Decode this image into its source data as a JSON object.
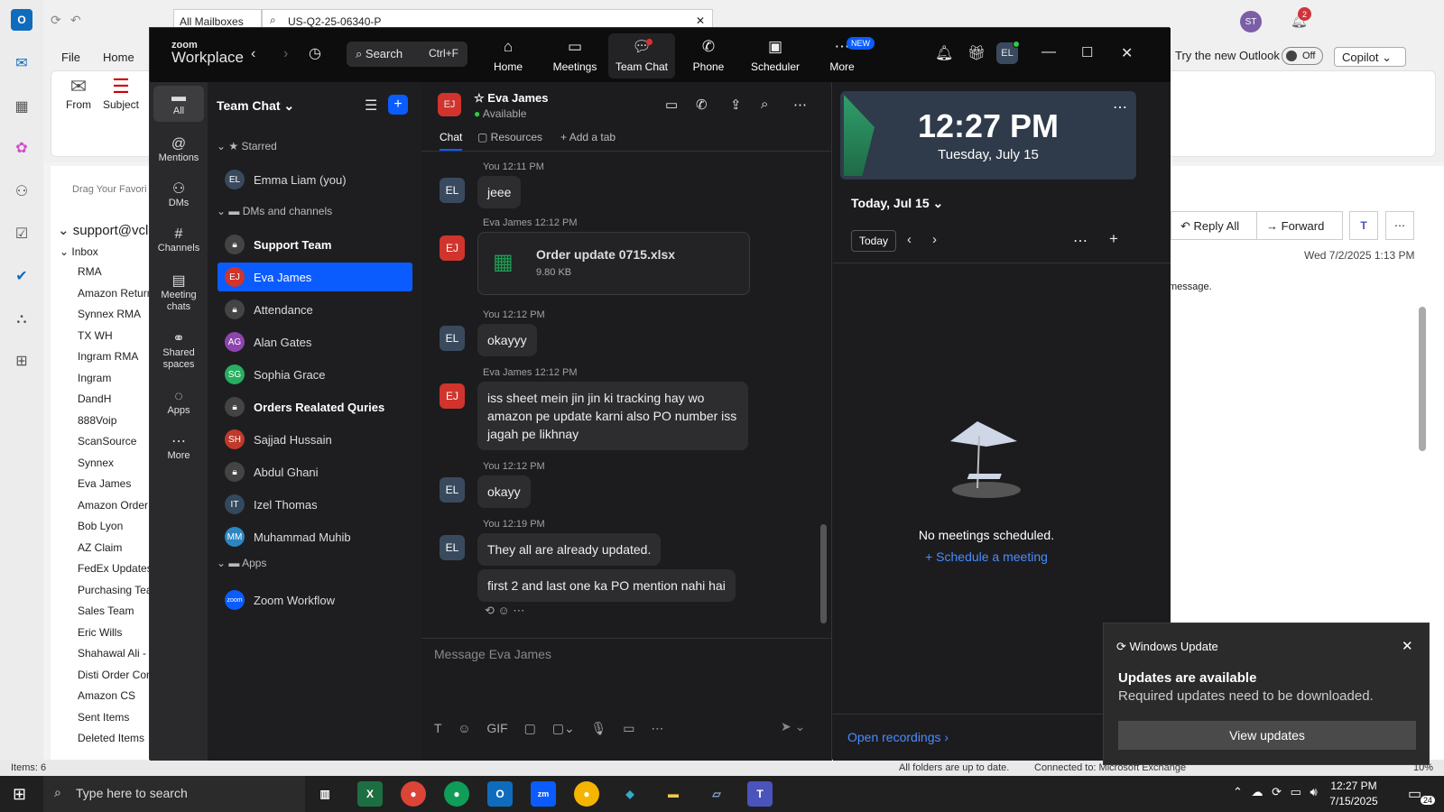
{
  "outlook": {
    "mailbox_select": "All Mailboxes",
    "search_value": "US-Q2-25-06340-P",
    "menu": [
      "File",
      "Home"
    ],
    "ribbon": {
      "from": "From",
      "subject": "Subject"
    },
    "drag_favorites": "Drag Your Favori",
    "account": "support@vclc",
    "inbox": "Inbox",
    "folders": [
      "RMA",
      "Amazon Return",
      "Synnex RMA",
      "TX WH",
      "Ingram RMA",
      "Ingram",
      "DandH",
      "888Voip",
      "ScanSource",
      "Synnex",
      "Eva James",
      "Amazon Order",
      "Bob Lyon",
      "AZ Claim",
      "FedEx Updates",
      "Purchasing Tea",
      "Sales Team",
      "Eric Wills",
      "Shahawal Ali -",
      "Disti Order Con",
      "Amazon CS",
      "Sent Items",
      "Deleted Items"
    ],
    "try_new": "Try the new Outlook",
    "toggle": "Off",
    "copilot": "Copilot",
    "user_initials": "ST",
    "notif_count": "2",
    "reply_all": "Reply All",
    "forward": "Forward",
    "date": "Wed 7/2/2025 1:13 PM",
    "message_snippet": "message.",
    "status_items": "Items: 6",
    "status_folders": "All folders are up to date.",
    "status_conn": "Connected to: Microsoft Exchange",
    "zoom_pct": "10%"
  },
  "zoom": {
    "brand_top": "zoom",
    "brand": "Workplace",
    "search": "Search",
    "search_shortcut": "Ctrl+F",
    "nav": [
      {
        "label": "Home"
      },
      {
        "label": "Meetings"
      },
      {
        "label": "Team Chat"
      },
      {
        "label": "Phone"
      },
      {
        "label": "Scheduler"
      },
      {
        "label": "More",
        "badge": "NEW"
      }
    ],
    "avatar": "EL",
    "side": [
      {
        "label": "All"
      },
      {
        "label": "Mentions"
      },
      {
        "label": "DMs"
      },
      {
        "label": "Channels"
      },
      {
        "label": "Meeting chats"
      },
      {
        "label": "Shared spaces"
      },
      {
        "label": "Apps"
      },
      {
        "label": "More"
      }
    ],
    "list_title": "Team Chat",
    "sections": {
      "starred": "Starred",
      "dms": "DMs and channels",
      "apps": "Apps"
    },
    "items": [
      {
        "initials": "EL",
        "name": "Emma Liam (you)",
        "color": "#3a4a5e"
      },
      {
        "initials": "",
        "name": "Support Team",
        "bold": true
      },
      {
        "initials": "EJ",
        "name": "Eva James",
        "color": "#d0342c"
      },
      {
        "initials": "",
        "name": "Attendance"
      },
      {
        "initials": "AG",
        "name": "Alan Gates",
        "color": "#8e44ad"
      },
      {
        "initials": "SG",
        "name": "Sophia Grace",
        "color": "#27ae60"
      },
      {
        "initials": "",
        "name": "Orders Realated Quries",
        "bold": true
      },
      {
        "initials": "SH",
        "name": "Sajjad Hussain",
        "color": "#c0392b"
      },
      {
        "initials": "",
        "name": "Abdul Ghani",
        "color": "#777"
      },
      {
        "initials": "IT",
        "name": "Izel Thomas",
        "color": "#34495e"
      },
      {
        "initials": "MM",
        "name": "Muhammad Muhib",
        "color": "#2e86c1"
      },
      {
        "initials": "zoom",
        "name": "Zoom Workflow",
        "color": "#0b5cff"
      }
    ],
    "chat": {
      "name": "Eva James",
      "status": "Available",
      "initials": "EJ",
      "tabs": [
        "Chat",
        "Resources",
        "Add a tab"
      ],
      "messages": [
        {
          "header": "You 12:11 PM",
          "text": "jeee"
        },
        {
          "header": "Eva James 12:12 PM",
          "file": "Order update 0715.xlsx",
          "size": "9.80 KB"
        },
        {
          "header": "You 12:12 PM",
          "text": "okayyy"
        },
        {
          "header": "Eva James 12:12 PM",
          "text": "iss sheet mein jin jin ki tracking hay wo amazon pe update karni also PO number iss jagah pe likhnay"
        },
        {
          "header": "You 12:12 PM",
          "text": "okayy"
        },
        {
          "header": "You 12:19 PM",
          "text": "They all are already updated."
        },
        {
          "header": "",
          "text": "first 2 and last one ka PO mention nahi hai"
        }
      ],
      "placeholder": "Message Eva James"
    },
    "cal": {
      "time": "12:27 PM",
      "date": "Tuesday, July 15",
      "today_label": "Today, Jul 15",
      "today_btn": "Today",
      "empty": "No meetings scheduled.",
      "schedule": "Schedule a meeting",
      "recordings": "Open recordings"
    }
  },
  "notification": {
    "app": "Windows Update",
    "title": "Updates are available",
    "body": "Required updates need to be downloaded.",
    "button": "View updates"
  },
  "taskbar": {
    "search": "Type here to search",
    "time": "12:27 PM",
    "date": "7/15/2025",
    "badge": "24"
  }
}
